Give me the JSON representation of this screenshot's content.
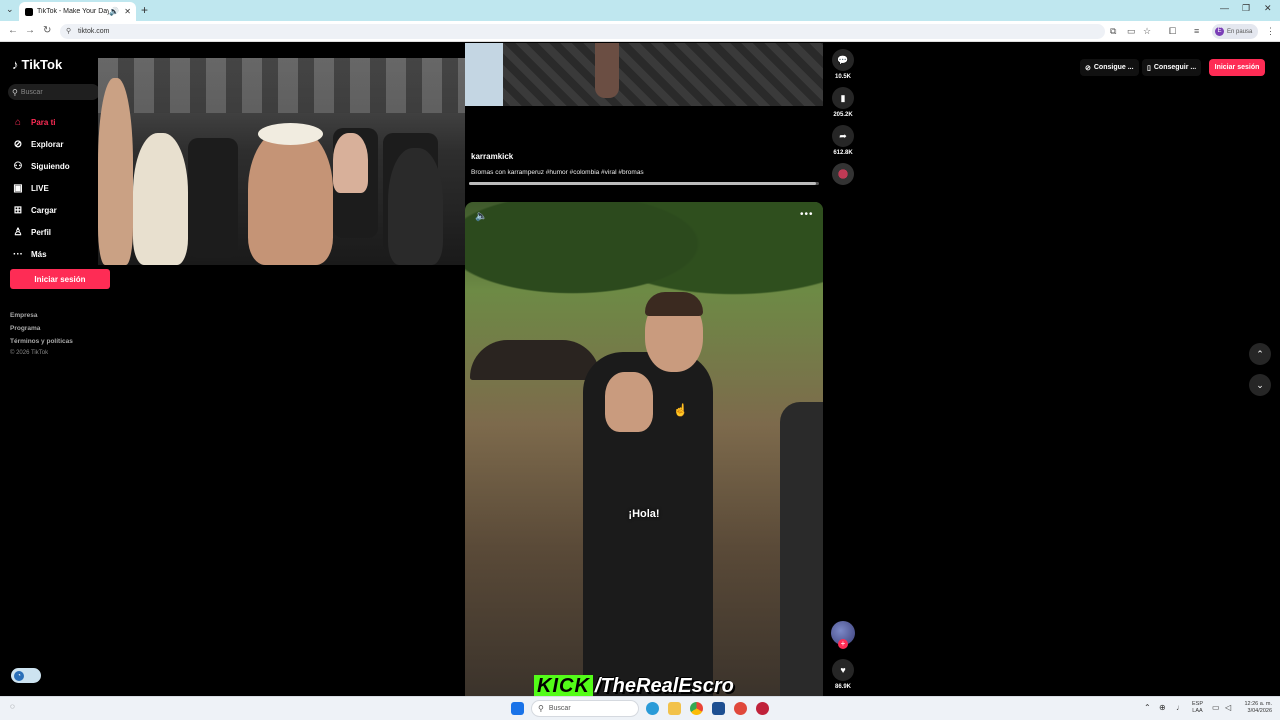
{
  "browser": {
    "tab_title": "TikTok - Make Your Day",
    "url": "tiktok.com",
    "profile_status": "En pausa",
    "profile_initial": "E"
  },
  "sidebar": {
    "logo": "TikTok",
    "search_placeholder": "Buscar",
    "items": [
      {
        "label": "Para ti",
        "icon": "home-icon"
      },
      {
        "label": "Explorar",
        "icon": "compass-icon"
      },
      {
        "label": "Siguiendo",
        "icon": "user-follow-icon"
      },
      {
        "label": "LIVE",
        "icon": "live-icon"
      },
      {
        "label": "Cargar",
        "icon": "upload-icon"
      },
      {
        "label": "Perfil",
        "icon": "profile-icon"
      },
      {
        "label": "Más",
        "icon": "more-icon"
      }
    ],
    "login_label": "Iniciar sesión",
    "footer": [
      "Empresa",
      "Programa",
      "Términos y políticas"
    ],
    "copyright": "© 2026 TikTok"
  },
  "prev_video": {
    "author": "karramkick",
    "description": "Bromas con karramperuz #humor #colombia #viral #bromas",
    "progress": 0.99,
    "actions": [
      {
        "icon": "comment-icon",
        "count": "10.5K"
      },
      {
        "icon": "bookmark-icon",
        "count": "205.2K"
      },
      {
        "icon": "share-icon",
        "count": "612.8K"
      }
    ]
  },
  "main_video": {
    "caption": "¡Hola!",
    "like_count": "86.9K"
  },
  "header_right": {
    "btn1": "Consigue ...",
    "btn2": "Conseguir ...",
    "login": "Iniciar sesión"
  },
  "overlay": {
    "brand": "KICK",
    "handle": "/TheRealEscro"
  },
  "taskbar": {
    "search_placeholder": "Buscar",
    "lang_top": "ESP",
    "lang_bottom": "LAA",
    "time": "12:26 a. m.",
    "date": "3/04/2026"
  },
  "colors": {
    "accent": "#fe2c55",
    "kick_green": "#53fc18"
  }
}
